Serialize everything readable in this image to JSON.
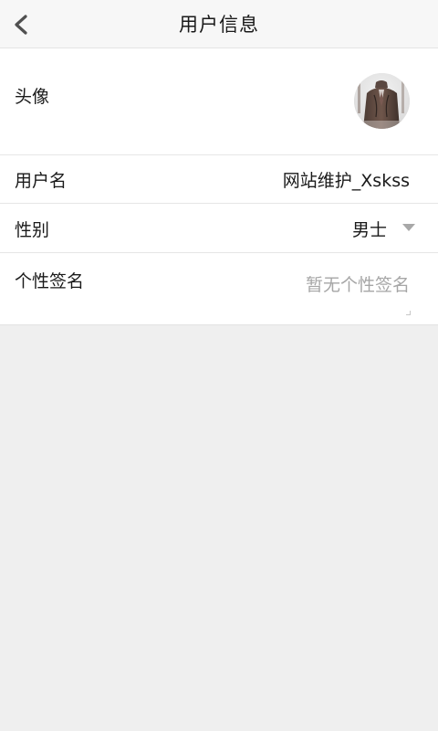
{
  "header": {
    "title": "用户信息",
    "back_icon": "chevron-left-icon"
  },
  "profile": {
    "avatar_label": "头像",
    "username_label": "用户名",
    "username_value": "网站维护_Xskss",
    "gender_label": "性别",
    "gender_value": "男士",
    "gender_icon": "caret-down-icon",
    "signature_label": "个性签名",
    "signature_value": "",
    "signature_placeholder": "暂无个性签名"
  },
  "colors": {
    "header_bg": "#f7f7f7",
    "page_bg": "#efefef",
    "card_bg": "#ffffff",
    "text": "#1a1a1a",
    "placeholder": "#a6a6a6",
    "divider": "#e6e6e6"
  }
}
